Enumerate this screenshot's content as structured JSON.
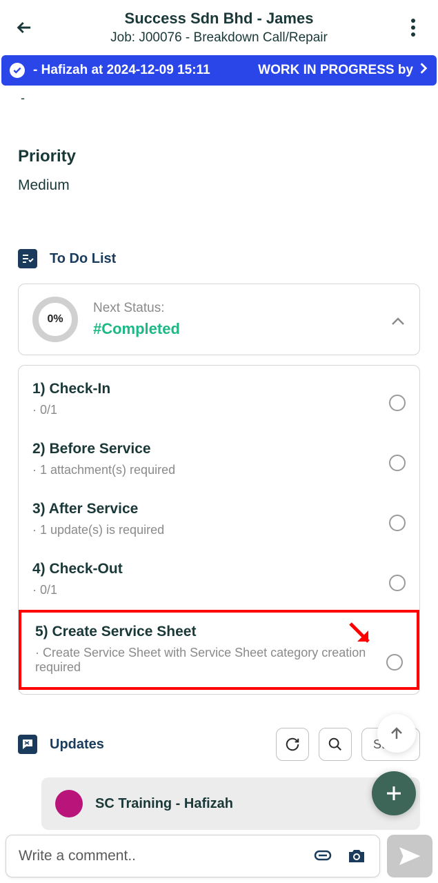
{
  "header": {
    "title": "Success Sdn Bhd  - James",
    "subtitle": "Job: J00076 - Breakdown Call/Repair"
  },
  "statusBar": {
    "left": "- Hafizah at 2024-12-09 15:11",
    "right": "WORK IN PROGRESS by "
  },
  "dash": "-",
  "priority": {
    "label": "Priority",
    "value": "Medium"
  },
  "todo": {
    "section_title": "To Do List",
    "progress": "0%",
    "next_status_label": "Next Status:",
    "next_status_value": "#Completed",
    "items": [
      {
        "title": "1) Check-In",
        "sub": "· 0/1"
      },
      {
        "title": "2) Before Service",
        "sub": "· 1 attachment(s) required"
      },
      {
        "title": "3) After Service",
        "sub": "· 1 update(s) is required"
      },
      {
        "title": "4) Check-Out",
        "sub": "· 0/1"
      },
      {
        "title": "5) Create Service Sheet",
        "sub": "· Create Service Sheet with Service Sheet category creation required"
      }
    ]
  },
  "updates": {
    "section_title": "Updates",
    "filter_label": "Status",
    "author": "SC Training - Hafizah"
  },
  "comment": {
    "placeholder": "Write a comment.."
  }
}
